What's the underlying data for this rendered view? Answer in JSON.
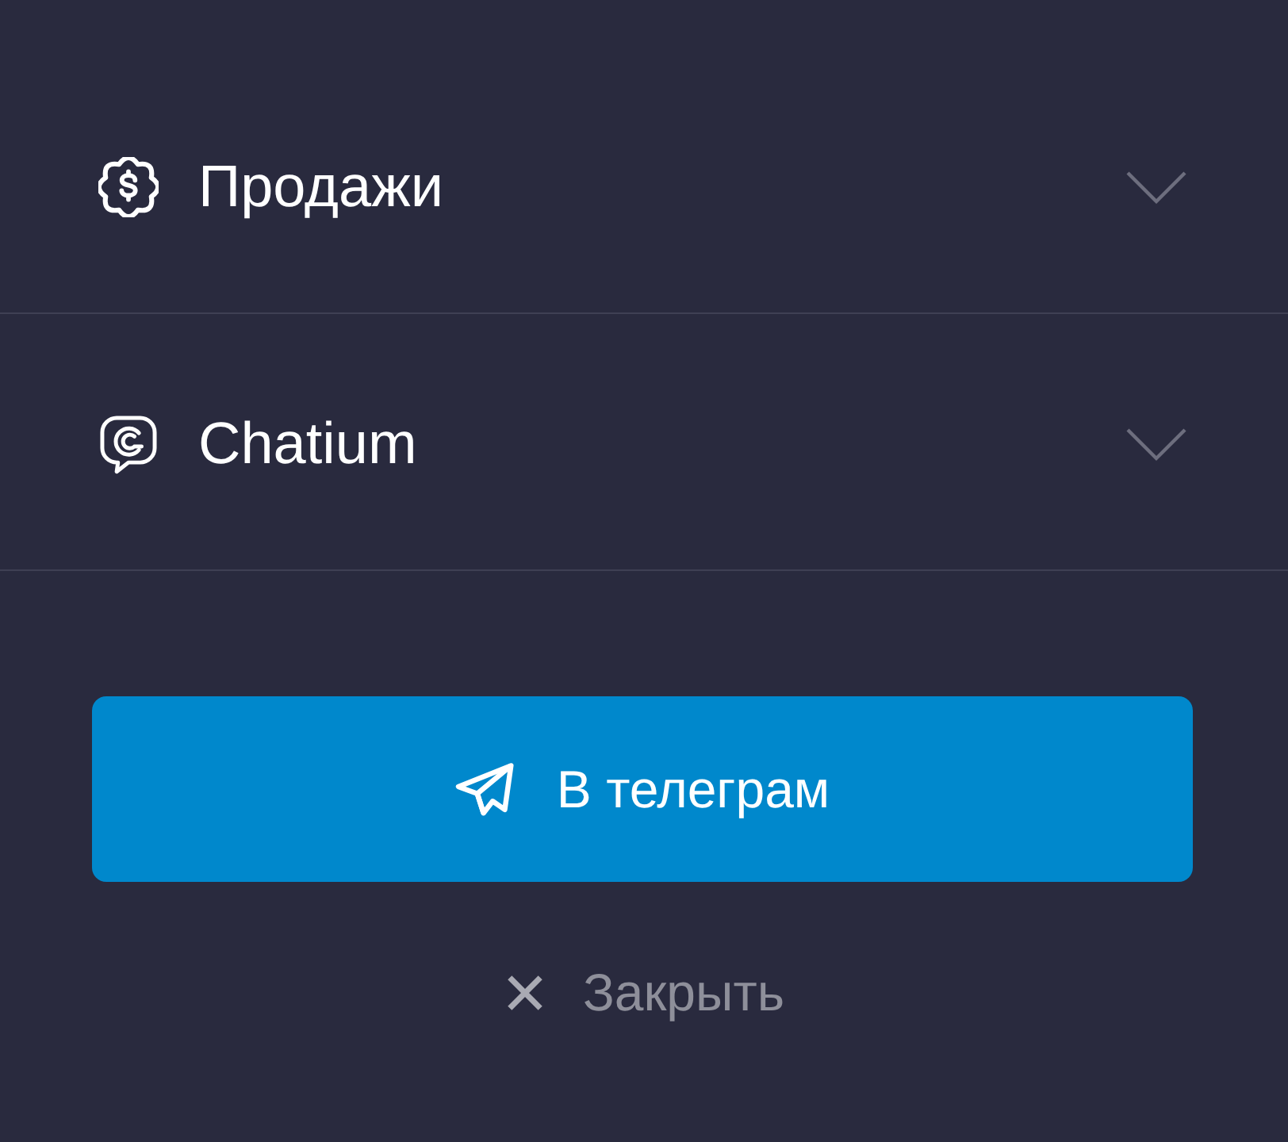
{
  "sections": [
    {
      "kind": "money",
      "title": "Продажи",
      "expanded": false
    },
    {
      "kind": "chat",
      "title": "Chatium",
      "expanded": false
    }
  ],
  "primary_button": {
    "label": "В телеграм"
  },
  "close_button": {
    "label": "Закрыть"
  }
}
